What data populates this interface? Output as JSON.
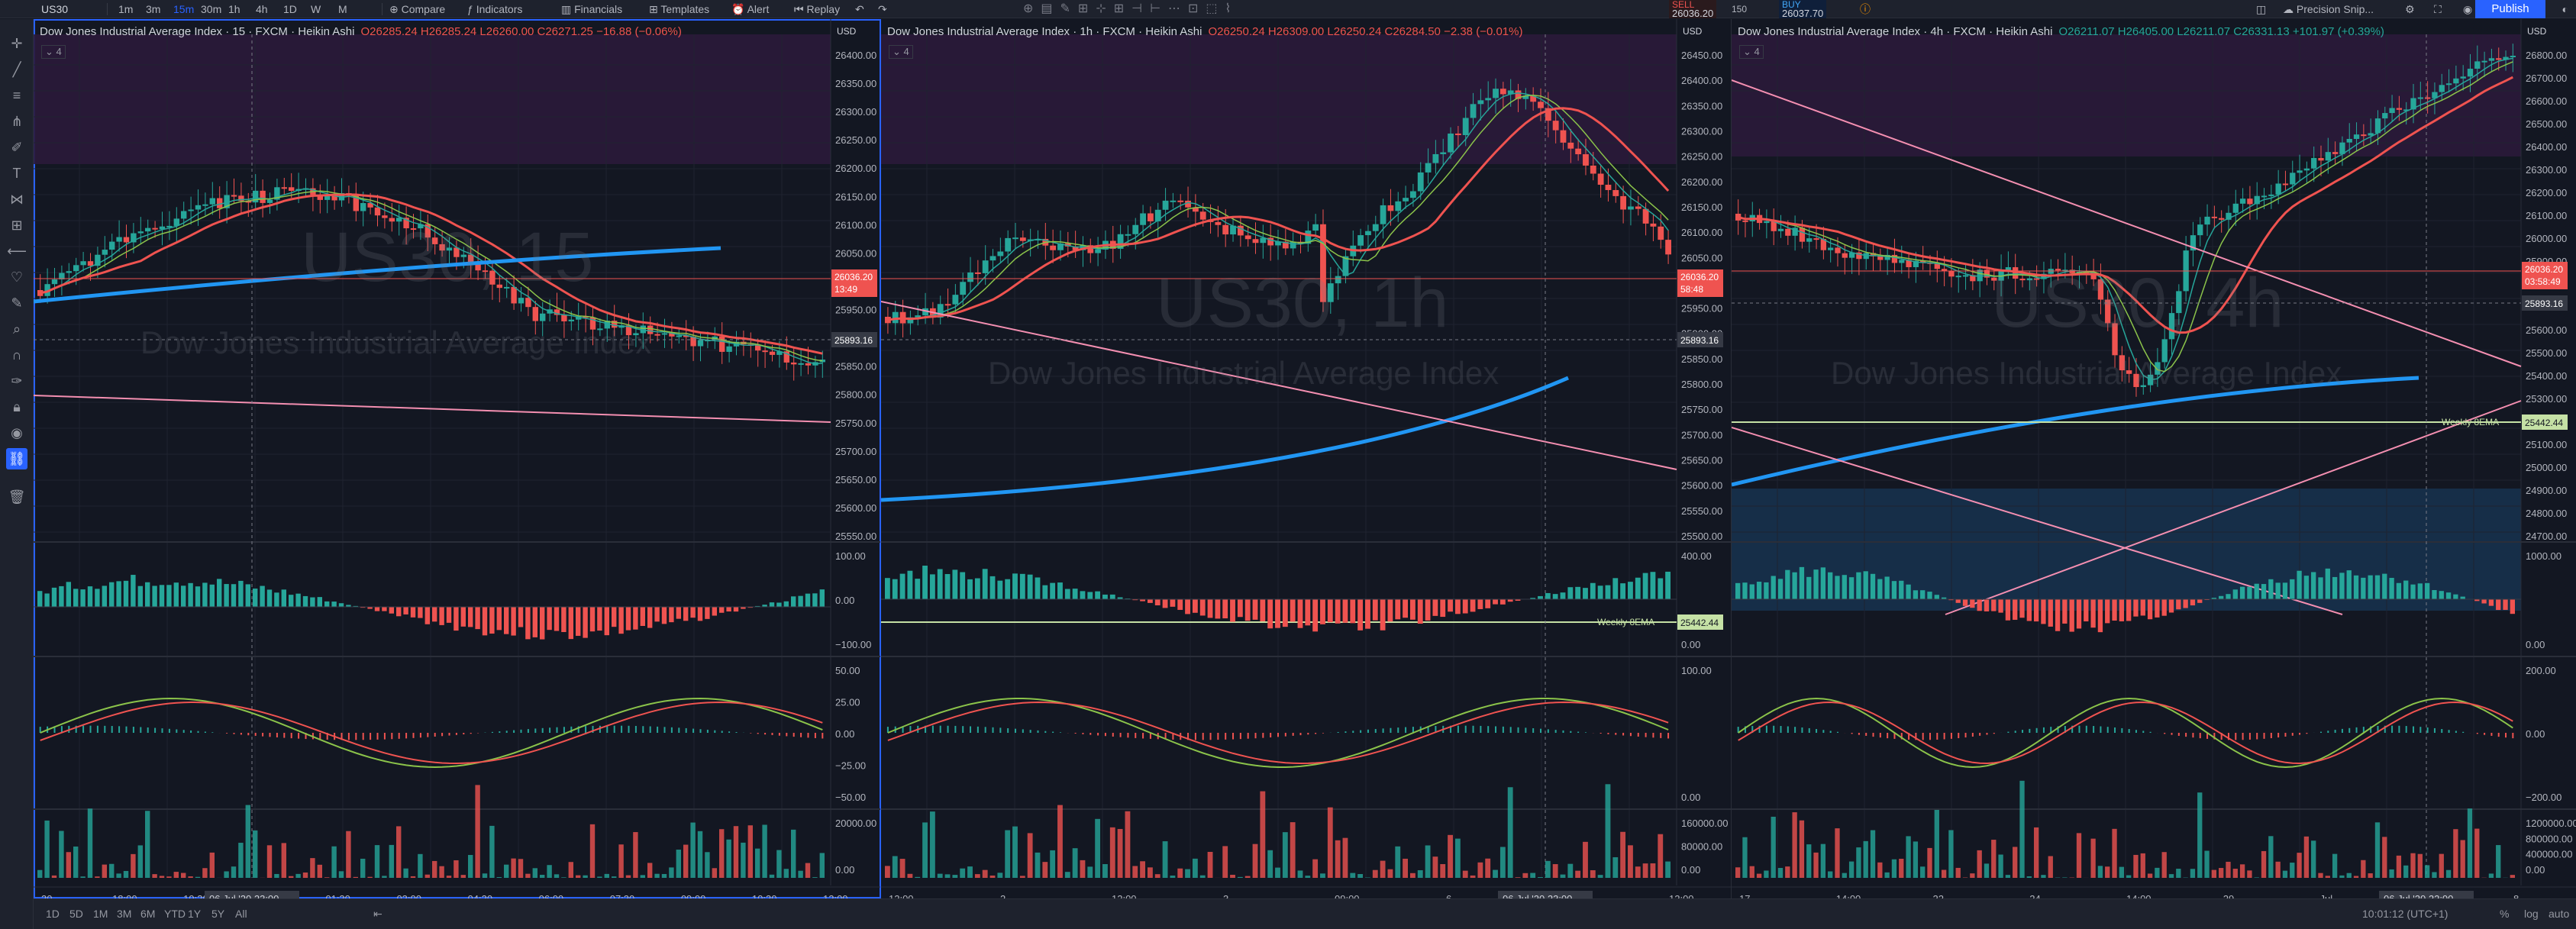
{
  "topbar": {
    "symbol": "US30",
    "timeframes": [
      "1m",
      "3m",
      "15m",
      "30m",
      "1h",
      "4h",
      "1D",
      "W",
      "M"
    ],
    "active_tf": "15m",
    "compare": "Compare",
    "indicators": "Indicators",
    "financials": "Financials",
    "templates": "Templates",
    "alert": "Alert",
    "replay": "Replay",
    "sell_label": "SELL",
    "sell_price": "26036.20",
    "spread": "150",
    "buy_label": "BUY",
    "buy_price": "26037.70",
    "layout_name": "Precision Snip...",
    "publish": "Publish"
  },
  "panes": [
    {
      "name": "Dow Jones Industrial Average Index",
      "interval": "15",
      "source": "FXCM",
      "charttype": "Heikin Ashi",
      "ohlc": "O26285.24 H26285.24 L26260.00 C26271.25 −16.88 (−0.06%)",
      "watermark": "US30, 15",
      "watermark_sub": "Dow Jones Industrial Average Index",
      "currency": "USD",
      "collapse": "4",
      "price_ticks": [
        "26400.00",
        "26350.00",
        "26300.00",
        "26250.00",
        "26200.00",
        "26150.00",
        "26100.00",
        "26050.00",
        "26000.00",
        "25950.00",
        "25900.00",
        "25850.00",
        "25800.00",
        "25750.00",
        "25700.00",
        "25650.00",
        "25600.00",
        "25550.00"
      ],
      "price_tag": "26036.20",
      "countdown": "13:49",
      "cross_tag": "25893.16",
      "ind1_ticks": [
        "100.00",
        "0.00",
        "−100.00"
      ],
      "ind2_ticks": [
        "50.00",
        "25.00",
        "0.00",
        "−25.00",
        "−50.00"
      ],
      "vol_ticks": [
        "20000.00",
        "0.00"
      ],
      "time_ticks": [
        "30",
        "18:00",
        "19:30",
        "21:00",
        "01:30",
        "03:00",
        "04:30",
        "06:00",
        "07:30",
        "09:00",
        "10:30",
        "12:00"
      ],
      "time_hl": "06 Jul '20  23:00"
    },
    {
      "name": "Dow Jones Industrial Average Index",
      "interval": "1h",
      "source": "FXCM",
      "charttype": "Heikin Ashi",
      "ohlc": "O26250.24 H26309.00 L26250.24 C26284.50 −2.38 (−0.01%)",
      "watermark": "US30, 1h",
      "watermark_sub": "Dow Jones Industrial Average Index",
      "currency": "USD",
      "collapse": "4",
      "price_ticks": [
        "26450.00",
        "26400.00",
        "26350.00",
        "26300.00",
        "26250.00",
        "26200.00",
        "26150.00",
        "26100.00",
        "26050.00",
        "26000.00",
        "25950.00",
        "25900.00",
        "25850.00",
        "25800.00",
        "25750.00",
        "25700.00",
        "25650.00",
        "25600.00",
        "25550.00",
        "25500.00"
      ],
      "price_tag": "26036.20",
      "countdown": "58:48",
      "cross_tag": "25893.16",
      "weekly_label": "Weekly 8EMA",
      "weekly_tag": "25442.44",
      "ind1_ticks": [
        "400.00",
        "0.00"
      ],
      "ind2_ticks": [
        "100.00",
        "0.00"
      ],
      "vol_ticks": [
        "160000.00",
        "80000.00",
        "0.00"
      ],
      "time_ticks": [
        "12:00",
        "2",
        "12:00",
        "3",
        "09:00",
        "6",
        "12:00",
        "12:00"
      ],
      "time_hl": "06 Jul '20  23:00"
    },
    {
      "name": "Dow Jones Industrial Average Index",
      "interval": "4h",
      "source": "FXCM",
      "charttype": "Heikin Ashi",
      "ohlc": "O26211.07 H26405.00 L26211.07 C26331.13 +101.97 (+0.39%)",
      "watermark": "US30, 4h",
      "watermark_sub": "Dow Jones Industrial Average Index",
      "currency": "USD",
      "collapse": "4",
      "price_ticks": [
        "26800.00",
        "26700.00",
        "26600.00",
        "26500.00",
        "26400.00",
        "26300.00",
        "26200.00",
        "26100.00",
        "26000.00",
        "25900.00",
        "25800.00",
        "25700.00",
        "25600.00",
        "25500.00",
        "25400.00",
        "25300.00",
        "25200.00",
        "25100.00",
        "25000.00",
        "24900.00",
        "24800.00",
        "24700.00"
      ],
      "price_tag": "26036.20",
      "countdown": "03:58:49",
      "cross_tag": "25893.16",
      "weekly_label": "Weekly 8EMA",
      "weekly_tag": "25442.44",
      "ind1_ticks": [
        "1000.00",
        "0.00"
      ],
      "ind2_ticks": [
        "200.00",
        "0.00",
        "−200.00"
      ],
      "vol_ticks": [
        "1200000.00",
        "800000.00",
        "400000.00",
        "0.00"
      ],
      "time_ticks": [
        "17",
        "14:00",
        "22",
        "24",
        "14:00",
        "29",
        "Jul",
        "14:00",
        "8"
      ],
      "time_hl": "06 Jul '20  22:00"
    }
  ],
  "bottombar": {
    "ranges": [
      "1D",
      "5D",
      "1M",
      "3M",
      "6M",
      "YTD",
      "1Y",
      "5Y",
      "All"
    ],
    "clock": "10:01:12 (UTC+1)",
    "pct": "%",
    "log": "log",
    "auto": "auto"
  },
  "colors": {
    "up": "#26a69a",
    "down": "#ef5350",
    "accent": "#2962ff",
    "ema_blue": "#2196f3",
    "zone_purple": "#3b1f4a",
    "zone_blue": "#1b3a5c"
  }
}
